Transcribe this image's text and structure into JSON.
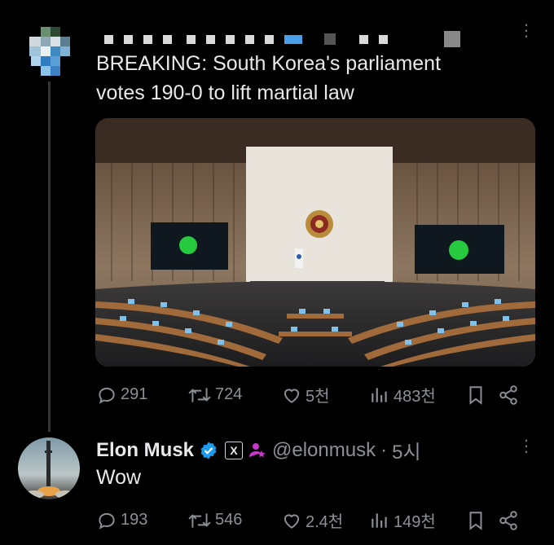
{
  "tweet": {
    "author_name_obscured": "censored",
    "text_line1": "BREAKING: South Korea's parliament",
    "text_line2": "votes 190-0 to lift martial law",
    "media_icon": "parliament-photo",
    "stats": {
      "replies": "291",
      "reposts": "724",
      "likes": "5천",
      "views": "483천"
    }
  },
  "reply": {
    "name": "Elon Musk",
    "handle": "@elonmusk",
    "separator": "·",
    "time": "5시",
    "text": "Wow",
    "stats": {
      "replies": "193",
      "reposts": "546",
      "likes": "2.4천",
      "views": "149천"
    }
  },
  "icons": {
    "more": "more-vertical-icon",
    "reply": "reply-icon",
    "repost": "repost-icon",
    "like": "heart-icon",
    "views": "views-icon",
    "bookmark": "bookmark-icon",
    "share": "share-icon",
    "verified": "verified-badge-icon",
    "affiliate": "x-affiliate-icon",
    "subscription": "subscription-icon"
  },
  "colors": {
    "background": "#000000",
    "text": "#e7e9ea",
    "muted": "#8b9096",
    "verified": "#1d9bf0",
    "subscription": "#c936cc"
  }
}
